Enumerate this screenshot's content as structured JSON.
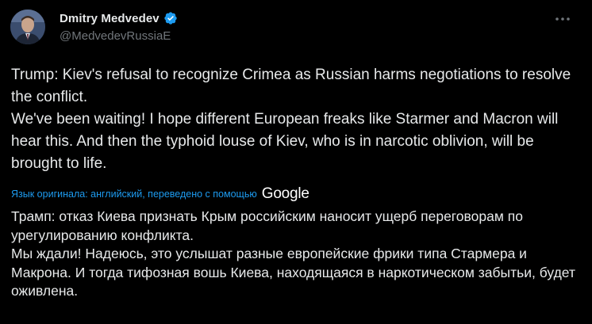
{
  "author": {
    "display_name": "Dmitry Medvedev",
    "handle": "@MedvedevRussiaE",
    "verified_badge": "verified-badge-icon",
    "avatar": "avatar-photo"
  },
  "actions": {
    "more_icon": "more-horizontal-icon"
  },
  "post": {
    "original_lines": [
      "Trump: Kiev's refusal to recognize Crimea as Russian harms negotiations to resolve the conflict.",
      "We've been waiting! I hope different European freaks like Starmer and Macron will hear this. And then the typhoid louse of Kiev, who is in narcotic oblivion, will be brought to life."
    ],
    "translation_note": "Язык оригинала: английский, переведено с помощью",
    "translation_provider": "Google",
    "translated_lines": [
      "Трамп: отказ Киева признать Крым российским наносит ущерб переговорам по урегулированию конфликта.",
      "Мы ждали! Надеюсь, это услышат разные европейские фрики типа Стармера и Макрона. И тогда тифозная вошь Киева, находящаяся в наркотическом забытьи, будет оживлена."
    ]
  },
  "colors": {
    "background": "#000000",
    "text_primary": "#e7e9ea",
    "text_secondary": "#71767b",
    "link": "#1d9bf0",
    "verified": "#1d9bf0"
  }
}
